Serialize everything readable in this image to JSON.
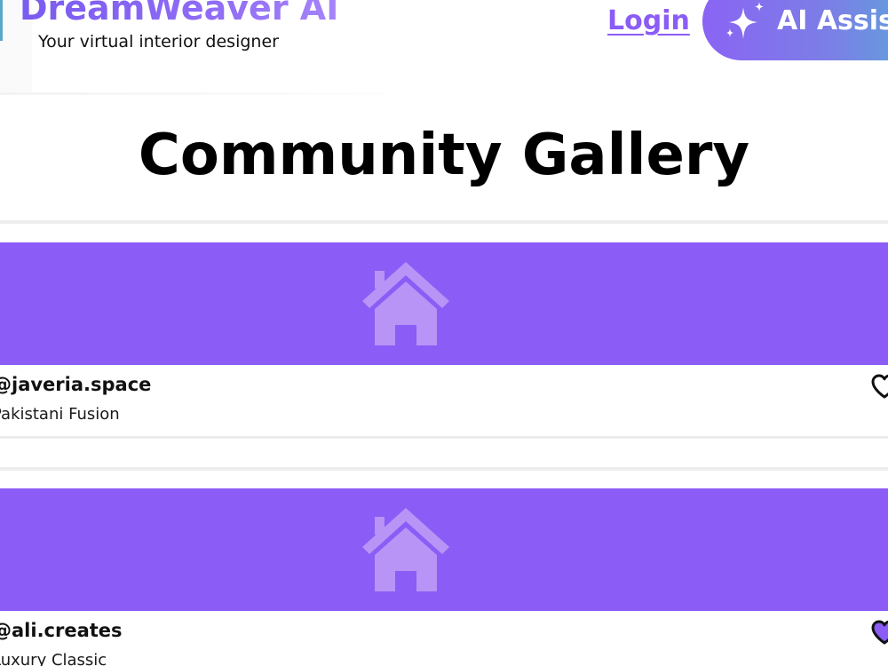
{
  "header": {
    "brand_title": "DreamWeaver AI",
    "brand_tagline": "Your virtual interior designer",
    "login_label": "Login",
    "assist_label": "AI Assist"
  },
  "main": {
    "title": "Community Gallery"
  },
  "gallery": [
    {
      "user": "@javeria.space",
      "style": "Pakistani Fusion",
      "liked": false
    },
    {
      "user": "@ali.creates",
      "style": "Luxury Classic",
      "liked": true
    }
  ],
  "colors": {
    "accent": "#8b5cf6",
    "card_image_bg": "#8b5cf6",
    "house_icon": "#b794f6",
    "heart_liked": "#8b5cf6"
  },
  "icons": {
    "house": "house-icon",
    "heart": "heart-icon",
    "sparkle": "sparkle-icon"
  }
}
